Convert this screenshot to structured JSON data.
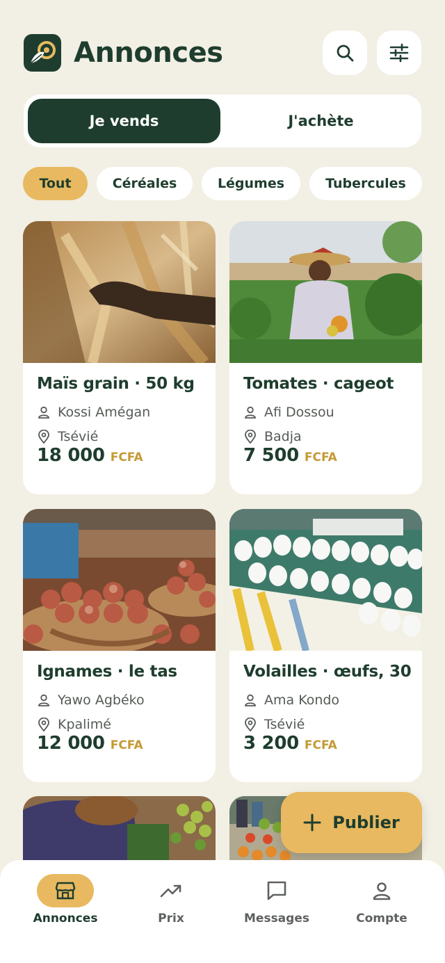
{
  "header": {
    "title": "Annonces",
    "logo_icon": "leaf-coin-logo",
    "search_icon": "search-icon",
    "filter_icon": "sliders-icon"
  },
  "segment": {
    "sell_label": "Je vends",
    "buy_label": "J'achète",
    "active": "sell"
  },
  "chips": [
    {
      "label": "Tout",
      "active": true
    },
    {
      "label": "Céréales",
      "active": false
    },
    {
      "label": "Légumes",
      "active": false
    },
    {
      "label": "Tubercules",
      "active": false
    }
  ],
  "listings": [
    {
      "title": "Maïs grain · 50 kg",
      "seller": "Kossi Amégan",
      "location": "Tsévié",
      "price": "18 000",
      "currency": "FCFA",
      "image": "corn-harvest-photo"
    },
    {
      "title": "Tomates · cageot",
      "seller": "Afi Dossou",
      "location": "Badja",
      "price": "7 500",
      "currency": "FCFA",
      "image": "farmer-field-photo"
    },
    {
      "title": "Ignames · le tas",
      "seller": "Yawo Agbéko",
      "location": "Kpalimé",
      "price": "12 000",
      "currency": "FCFA",
      "image": "yam-baskets-photo"
    },
    {
      "title": "Volailles · œufs, 30",
      "seller": "Ama Kondo",
      "location": "Tsévié",
      "price": "3 200",
      "currency": "FCFA",
      "image": "egg-trays-photo"
    }
  ],
  "fab": {
    "label": "Publier",
    "icon": "plus-icon"
  },
  "nav": [
    {
      "label": "Annonces",
      "icon": "storefront-icon",
      "active": true
    },
    {
      "label": "Prix",
      "icon": "trend-up-icon",
      "active": false
    },
    {
      "label": "Messages",
      "icon": "message-icon",
      "active": false
    },
    {
      "label": "Compte",
      "icon": "user-icon",
      "active": false
    }
  ],
  "colors": {
    "background": "#f2efe4",
    "primary": "#1e3d2e",
    "accent": "#e8b960",
    "currency": "#c49a35"
  }
}
